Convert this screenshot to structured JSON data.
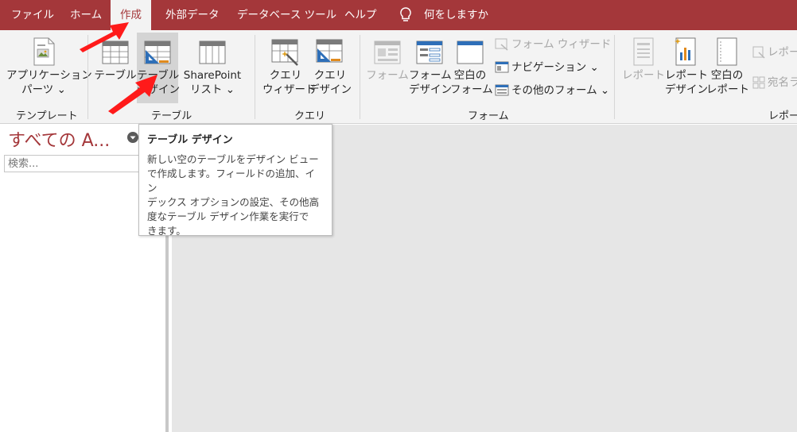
{
  "menu": {
    "tabs": [
      "ファイル",
      "ホーム",
      "作成",
      "外部データ",
      "データベース ツール",
      "ヘルプ"
    ],
    "active_index": 2,
    "tell_me": "何をしますか"
  },
  "ribbon": {
    "groups": {
      "template": "テンプレート",
      "table": "テーブル",
      "query": "クエリ",
      "form": "フォーム",
      "report": "レポート"
    },
    "buttons": {
      "app_parts": [
        "アプリケーション",
        "パーツ ⌄"
      ],
      "table": "テーブル",
      "table_design": [
        "テーブル",
        "デザイン"
      ],
      "sharepoint": [
        "SharePoint",
        "リスト ⌄"
      ],
      "query_wizard": [
        "クエリ",
        "ウィザード"
      ],
      "query_design": [
        "クエリ",
        "デザイン"
      ],
      "form": "フォーム",
      "form_design": [
        "フォーム",
        "デザイン"
      ],
      "blank_form": [
        "空白の",
        "フォーム"
      ],
      "form_wizard": "フォーム ウィザード",
      "navigation": "ナビゲーション ⌄",
      "more_forms": "その他のフォーム ⌄",
      "report": "レポート",
      "report_design": [
        "レポート",
        "デザイン"
      ],
      "blank_report": [
        "空白の",
        "レポート"
      ],
      "report_wizard": "レポー",
      "labels": "宛名ラ"
    }
  },
  "nav_pane": {
    "title": "すべての A...",
    "search_placeholder": "検索..."
  },
  "tooltip": {
    "title": "テーブル デザイン",
    "lines": [
      "新しい空のテーブルをデザイン ビュー",
      "で作成します。フィールドの追加、イン",
      "デックス オプションの設定、その他高",
      "度なテーブル デザイン作業を実行で",
      "きます。"
    ]
  },
  "colors": {
    "accent": "#a4373a",
    "ribbon_bg": "#f3f3f3",
    "workspace_bg": "#e6e6e6",
    "annotation_arrow": "#ff1a1a",
    "icon_blue": "#2e6fb8"
  }
}
